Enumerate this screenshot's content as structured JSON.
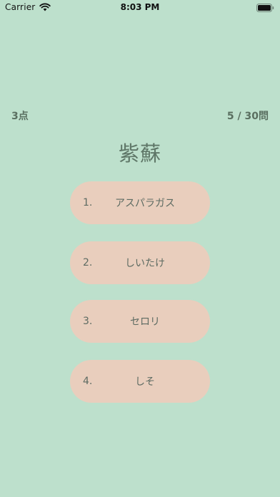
{
  "status_bar": {
    "carrier": "Carrier",
    "time": "8:03 PM",
    "icons": [
      "wifi-icon",
      "battery-icon"
    ]
  },
  "quiz": {
    "score": "3点",
    "progress": "5 / 30問",
    "question": "紫蘇",
    "answers": [
      {
        "number": "1.",
        "label": "アスパラガス"
      },
      {
        "number": "2.",
        "label": "しいたけ"
      },
      {
        "number": "3.",
        "label": "セロリ"
      },
      {
        "number": "4.",
        "label": "しそ"
      }
    ]
  },
  "colors": {
    "background": "#bde0cc",
    "button": "#e9cebd",
    "text": "#5a6f60"
  }
}
